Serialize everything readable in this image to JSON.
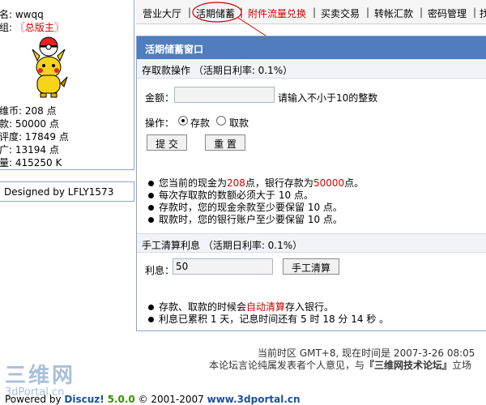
{
  "profile": {
    "name_line": "名: wwqq",
    "group_label": "组:",
    "group_value": "〖总版主〗",
    "stats": [
      "维币: 208 点",
      "款: 50000 点",
      "评度: 17849 点",
      "广: 13194 点",
      "量: 415250 K"
    ]
  },
  "designed_by": "Designed by LFLY1573",
  "nav": {
    "items": [
      "营业大厅",
      "活期储蓄",
      "附件流量兑换",
      "买卖交易",
      "转帐汇款",
      "密码管理",
      "找"
    ],
    "sep": "|"
  },
  "panel": {
    "title": "活期储蓄窗口",
    "deposit_section": "存取款操作 （活期日利率: 0.1%）",
    "amount_label": "金额：",
    "amount_value": "",
    "amount_hint": "请输入不小于10的整数",
    "op_label": "操作：",
    "op_deposit": "存款",
    "op_withdraw": "取款",
    "submit_btn": "提 交",
    "reset_btn": "重 置",
    "tips": [
      {
        "pre": "您当前的现金为",
        "v1": "208",
        "mid": "点，银行存款为",
        "v2": "50000",
        "post": "点。"
      },
      {
        "text": "每次存取款的数额必须大于 10 点。"
      },
      {
        "text": "存款时，您的现金余款至少要保留 10 点。"
      },
      {
        "text": "取款时，您的银行账户至少要保留 10 点。"
      }
    ],
    "settle_section": "手工清算利息 （活期日利率: 0.1%）",
    "interest_label": "利息：",
    "interest_value": "50",
    "settle_btn": "手工清算",
    "tips2_line1_pre": "存款、取款的时候会",
    "tips2_line1_red": "自动清算",
    "tips2_line1_post": "存入银行。",
    "tips2_line2": "利息已累积 1 天，记息时间还有 5 时 18 分 14 秒 。"
  },
  "footer": {
    "time": "当前时区 GMT+8, 现在时间是 2007-3-26 08:05",
    "disclaimer_pre": "本论坛言论纯属发表者个人意见，与",
    "disclaimer_bold": "『三维网技术论坛』",
    "disclaimer_post": "立场",
    "watermark_top": "三维网",
    "watermark_bottom": "3dPortal.cn",
    "powered_pre": "Powered by",
    "powered_brand": "Discuz!",
    "powered_version": "5.0.0",
    "copyright": "© 2001-2007",
    "site": "www.3dportal.cn"
  },
  "colors": {
    "panel_header": "#4f7dbd",
    "highlight_red": "#d40000",
    "annotation_red": "#cc0000",
    "discuz_green": "#3b8f00"
  }
}
